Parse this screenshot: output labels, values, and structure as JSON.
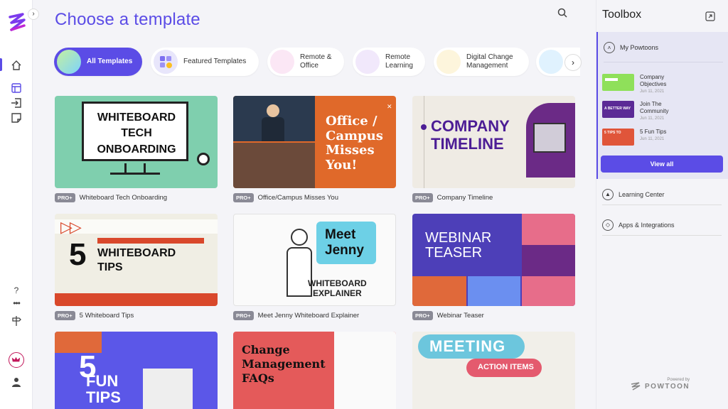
{
  "page": {
    "title": "Choose a template"
  },
  "colors": {
    "accent": "#5b4ce6",
    "badge": "#8a8a96",
    "rail_bg": "#ffffff",
    "panel_bg": "#e6e6f4"
  },
  "rail": {
    "expand_icon": "chevron-right-icon",
    "icons": [
      "home-icon",
      "layout-icon",
      "import-icon",
      "sticky-note-icon",
      "help-icon",
      "more-icon",
      "signpost-icon",
      "crown-icon",
      "user-icon"
    ]
  },
  "categories": [
    {
      "label": "All Templates",
      "active": true
    },
    {
      "label": "Featured Templates",
      "active": false
    },
    {
      "label": "Remote &\nOffice",
      "active": false
    },
    {
      "label": "Remote\nLearning",
      "active": false
    },
    {
      "label": "Digital Change\nManagement",
      "active": false
    }
  ],
  "templates": [
    {
      "badge": "PRO+",
      "name": "Whiteboard Tech Onboarding",
      "thumb_text": "WHITEBOARD\nTECH\nONBOARDING"
    },
    {
      "badge": "PRO+",
      "name": "Office/Campus Misses You",
      "thumb_text": "Office /\nCampus\nMisses\nYou!"
    },
    {
      "badge": "PRO+",
      "name": "Company Timeline",
      "thumb_text": "COMPANY\nTIMELINE"
    },
    {
      "badge": "PRO+",
      "name": "5 Whiteboard Tips",
      "thumb_text_big": "5",
      "thumb_text": "WHITEBOARD\nTIPS"
    },
    {
      "badge": "PRO+",
      "name": "Meet Jenny Whiteboard Explainer",
      "thumb_text": "Meet\nJenny",
      "thumb_sub": "WHITEBOARD\nEXPLAINER"
    },
    {
      "badge": "PRO+",
      "name": "Webinar Teaser",
      "thumb_text": "WEBINAR\nTEASER"
    },
    {
      "badge": "",
      "name": "",
      "thumb_text_big": "5",
      "thumb_text": "FUN\nTIPS"
    },
    {
      "badge": "",
      "name": "",
      "thumb_text": "Change\nManagement\nFAQs"
    },
    {
      "badge": "",
      "name": "",
      "thumb_text": "MEETING",
      "thumb_sub": "ACTION ITEMS"
    }
  ],
  "toolbox": {
    "title": "Toolbox",
    "my_powtoons": "My Powtoons",
    "items": [
      {
        "name": "Company\nObjectives",
        "date": "Jun 11, 2021",
        "thumb_text": ""
      },
      {
        "name": "Join The\nCommunity",
        "date": "Jun 11, 2021",
        "thumb_text": "A BETTER WAY"
      },
      {
        "name": "5 Fun Tips",
        "date": "Jun 11, 2021",
        "thumb_text": "5 TIPS TO"
      }
    ],
    "view_all": "View all",
    "learning_center": "Learning Center",
    "apps": "Apps & Integrations",
    "powered_by": "Powered by",
    "brand": "POWTOON"
  }
}
